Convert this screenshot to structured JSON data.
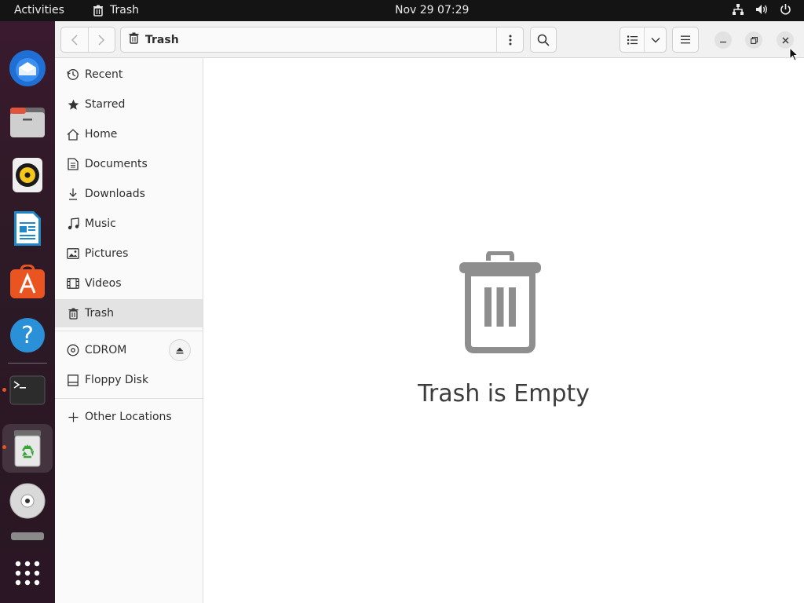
{
  "topbar": {
    "activities": "Activities",
    "app_name": "Trash",
    "clock": "Nov 29  07:29"
  },
  "headerbar": {
    "path_label": "Trash"
  },
  "sidebar": {
    "items": [
      {
        "label": "Recent",
        "icon": "clock-icon"
      },
      {
        "label": "Starred",
        "icon": "star-icon"
      },
      {
        "label": "Home",
        "icon": "home-icon"
      },
      {
        "label": "Documents",
        "icon": "document-icon"
      },
      {
        "label": "Downloads",
        "icon": "download-icon"
      },
      {
        "label": "Music",
        "icon": "music-icon"
      },
      {
        "label": "Pictures",
        "icon": "picture-icon"
      },
      {
        "label": "Videos",
        "icon": "video-icon"
      },
      {
        "label": "Trash",
        "icon": "trash-icon",
        "selected": true
      }
    ],
    "devices": [
      {
        "label": "CDROM",
        "icon": "disc-icon"
      },
      {
        "label": "Floppy Disk",
        "icon": "floppy-icon"
      }
    ],
    "other": {
      "label": "Other Locations",
      "icon": "plus-icon"
    }
  },
  "main": {
    "empty_message": "Trash is Empty"
  },
  "colors": {
    "accent": "#e95420",
    "selected_row": "#e3e3e3"
  }
}
